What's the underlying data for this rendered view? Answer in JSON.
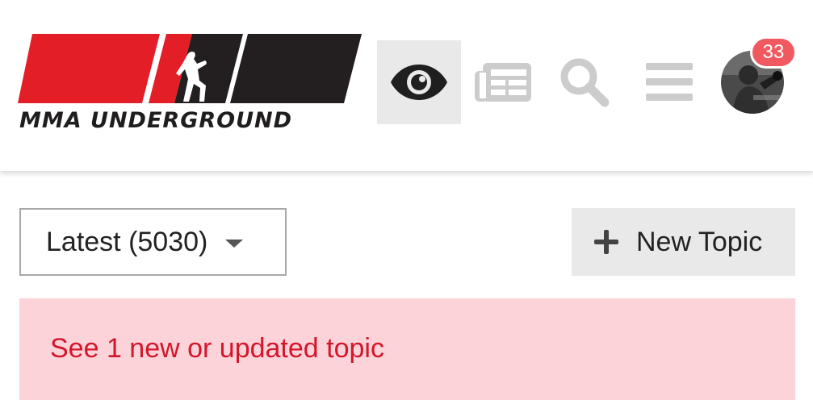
{
  "header": {
    "logo_text": "MMA UNDERGROUND",
    "nav_icons": [
      {
        "name": "eye-icon",
        "active": true
      },
      {
        "name": "newspaper-icon",
        "active": false
      },
      {
        "name": "search-icon",
        "active": false
      },
      {
        "name": "hamburger-menu-icon",
        "active": false
      }
    ],
    "notification_count": "33"
  },
  "toolbar": {
    "filter_label": "Latest (5030)",
    "new_topic_label": "New Topic"
  },
  "alert": {
    "text": "See 1 new or updated topic"
  },
  "colors": {
    "brand_red": "#e41e26",
    "brand_dark": "#231f20",
    "badge": "#f0595f",
    "alert_bg": "#fdd3da",
    "alert_text": "#d4162b",
    "icon_gray": "#cccccc"
  }
}
